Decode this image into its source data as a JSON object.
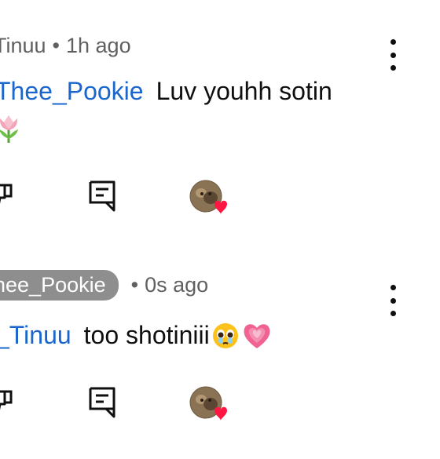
{
  "comments": [
    {
      "author": "Tinuu",
      "timestamp": "1h ago",
      "mention": "Thee_Pookie",
      "text": "Luv youhh sotin",
      "emoji": "tulip",
      "reply_icon": "comment-icon",
      "hearted_by": "creator-avatar"
    },
    {
      "author": "hee_Pookie",
      "timestamp": "0s ago",
      "mention": "_Tinuu",
      "text": "too shotiniii",
      "emoji": [
        "pleading-face",
        "growing-heart"
      ],
      "reply_icon": "comment-icon",
      "hearted_by": "creator-avatar"
    }
  ],
  "separator": "•",
  "colors": {
    "mention": "#1a66cc",
    "heart": "#ff1744",
    "meta": "#606060",
    "pill": "#8e8e8e"
  }
}
